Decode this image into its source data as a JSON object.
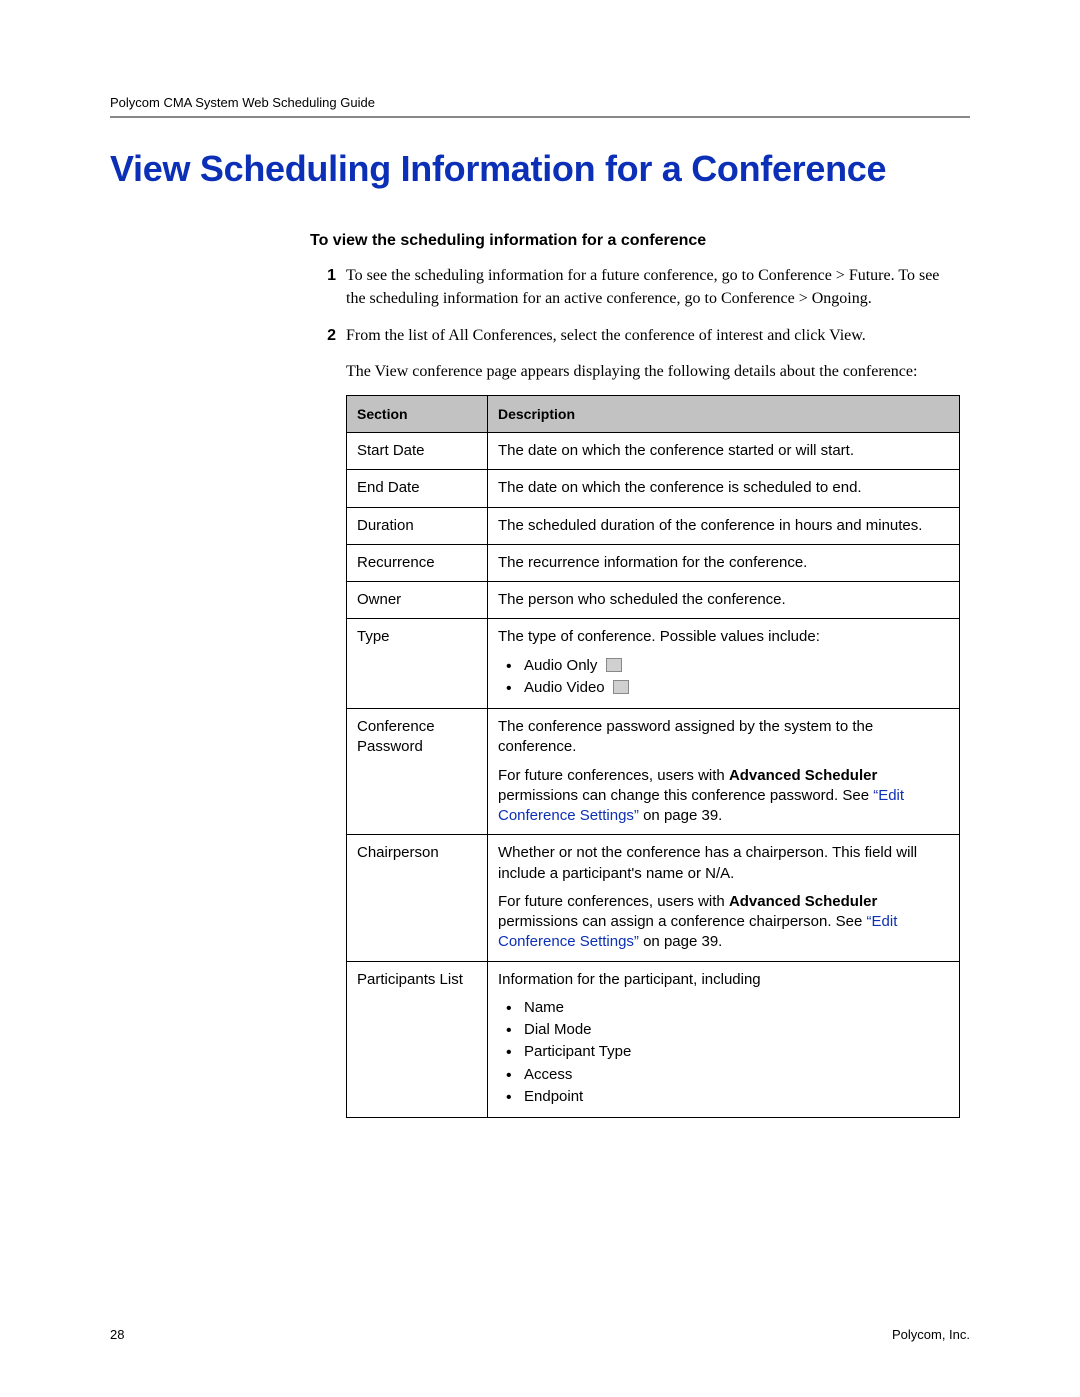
{
  "header": {
    "running": "Polycom CMA System Web Scheduling Guide"
  },
  "title": "View Scheduling Information for a Conference",
  "subhead": "To view the scheduling information for a conference",
  "steps": [
    {
      "num": "1",
      "text_pre": "To see the scheduling information for a future conference, go to ",
      "nav1_a": "Conference",
      "nav1_sep": " > ",
      "nav1_b": "Future",
      "text_mid": ". To see the scheduling information for an active conference, go to ",
      "nav2_a": "Conference",
      "nav2_sep": " > ",
      "nav2_b": "Ongoing",
      "text_end": "."
    },
    {
      "num": "2",
      "line1_pre": "From the list of ",
      "line1_bold": "All Conferences",
      "line1_mid": ", select the conference of interest and click ",
      "line1_bold2": "View",
      "line1_end": ".",
      "line2_pre": "The ",
      "line2_bold": "View",
      "line2_end": " conference page appears displaying the following details about the conference:"
    }
  ],
  "table": {
    "head_section": "Section",
    "head_description": "Description",
    "rows": {
      "start_date": {
        "section": "Start Date",
        "desc": "The date on which the conference started or will start."
      },
      "end_date": {
        "section": "End Date",
        "desc": "The date on which the conference is scheduled to end."
      },
      "duration": {
        "section": "Duration",
        "desc": "The scheduled duration of the conference in hours and minutes."
      },
      "recurrence": {
        "section": "Recurrence",
        "desc": "The recurrence information for the conference."
      },
      "owner": {
        "section": "Owner",
        "desc": "The person who scheduled the conference."
      },
      "type": {
        "section": "Type",
        "lead": "The type of conference. Possible values include:",
        "b1": "Audio Only",
        "b2": "Audio Video"
      },
      "conf_pw": {
        "section": "Conference Password",
        "p1": "The conference password assigned by the system to the conference.",
        "p2a": "For future conferences, users with ",
        "p2b": "Advanced Scheduler",
        "p2c": " permissions can change this conference password. See ",
        "link": "“Edit Conference Settings”",
        "p2d": " on page 39."
      },
      "chair": {
        "section": "Chairperson",
        "p1": "Whether or not the conference has a chairperson. This field will include a participant's name or N/A.",
        "p2a": "For future conferences, users with ",
        "p2b": "Advanced Scheduler",
        "p2c": " permissions can assign a conference chairperson. See ",
        "link": "“Edit Conference Settings”",
        "p2d": " on page 39."
      },
      "participants": {
        "section": "Participants List",
        "lead": "Information for the participant, including",
        "b1": "Name",
        "b2": "Dial Mode",
        "b3": "Participant Type",
        "b4": "Access",
        "b5": "Endpoint"
      }
    }
  },
  "footer": {
    "page": "28",
    "org": "Polycom, Inc."
  }
}
